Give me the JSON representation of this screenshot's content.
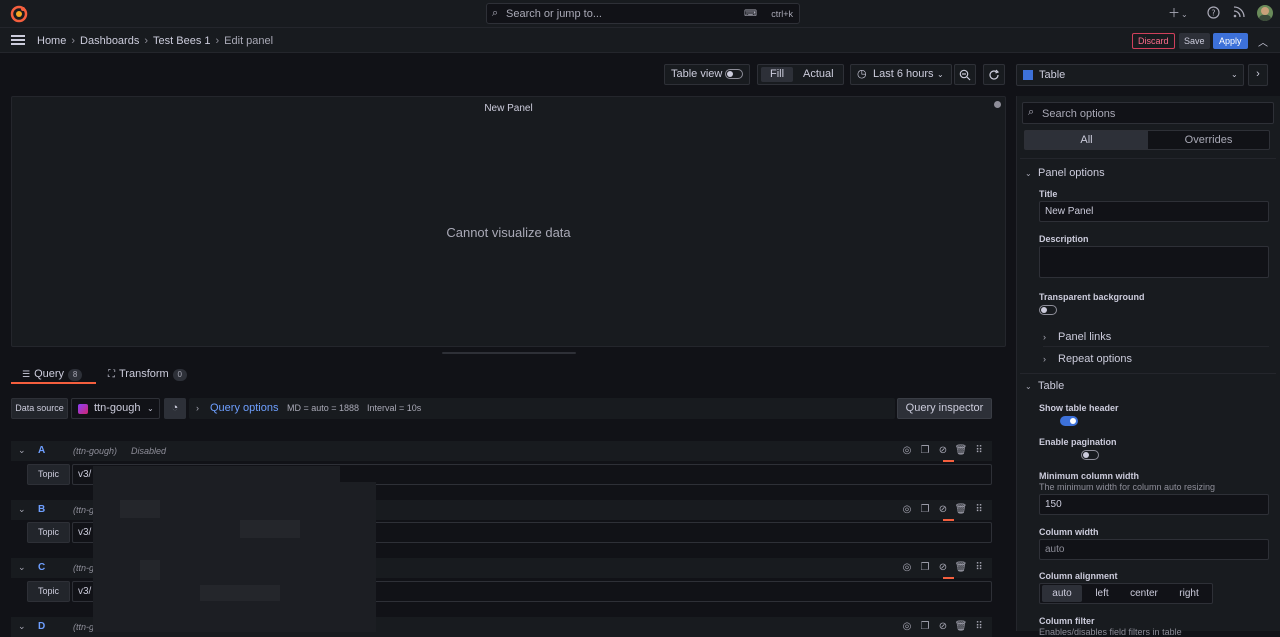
{
  "topbar": {
    "search_placeholder": "Search or jump to...",
    "search_shortcut": "ctrl+k",
    "icons": [
      "grafana-logo-icon",
      "search-icon",
      "keyboard-icon",
      "plus-icon",
      "help-icon",
      "news-icon",
      "avatar"
    ]
  },
  "breadcrumb": {
    "items": [
      "Home",
      "Dashboards",
      "Test Bees 1",
      "Edit panel"
    ]
  },
  "actions": {
    "discard": "Discard",
    "save": "Save",
    "apply": "Apply"
  },
  "toolbar": {
    "table_view": "Table view",
    "fill": "Fill",
    "actual": "Actual",
    "time_range": "Last 6 hours"
  },
  "panel": {
    "title": "New Panel",
    "message": "Cannot visualize data"
  },
  "tabs": {
    "query_label": "Query",
    "query_count": "8",
    "transform_label": "Transform",
    "transform_count": "0"
  },
  "datasource": {
    "label": "Data source",
    "value": "ttn-gough",
    "query_options": "Query options",
    "md": "MD = auto = 1888",
    "interval": "Interval = 10s",
    "inspector": "Query inspector"
  },
  "queries": [
    {
      "ref": "A",
      "source": "(ttn-gough)",
      "status": "Disabled",
      "topic_label": "Topic",
      "topic_value": "v3/"
    },
    {
      "ref": "B",
      "source": "(ttn-g",
      "status": "",
      "topic_label": "Topic",
      "topic_value": "v3/"
    },
    {
      "ref": "C",
      "source": "(ttn-g",
      "status": "",
      "topic_label": "Topic",
      "topic_value": "v3/"
    },
    {
      "ref": "D",
      "source": "(ttn-g",
      "status": "",
      "topic_label": "",
      "topic_value": ""
    }
  ],
  "sidebar": {
    "viz_name": "Table",
    "search_placeholder": "Search options",
    "seg_all": "All",
    "seg_overrides": "Overrides",
    "panel_options": "Panel options",
    "title_label": "Title",
    "title_value": "New Panel",
    "description_label": "Description",
    "transparent_label": "Transparent background",
    "panel_links": "Panel links",
    "repeat_options": "Repeat options",
    "table_section": "Table",
    "show_header_label": "Show table header",
    "pagination_label": "Enable pagination",
    "min_width_label": "Minimum column width",
    "min_width_desc": "The minimum width for column auto resizing",
    "min_width_value": "150",
    "col_width_label": "Column width",
    "col_width_placeholder": "auto",
    "col_align_label": "Column alignment",
    "align_options": [
      "auto",
      "left",
      "center",
      "right"
    ],
    "col_filter_label": "Column filter",
    "col_filter_desc": "Enables/disables field filters in table"
  },
  "colors": {
    "accent": "#3d71d9",
    "orange": "#f55f3e",
    "discard": "#d0405b",
    "background": "#111217",
    "panel": "#181b1f"
  }
}
